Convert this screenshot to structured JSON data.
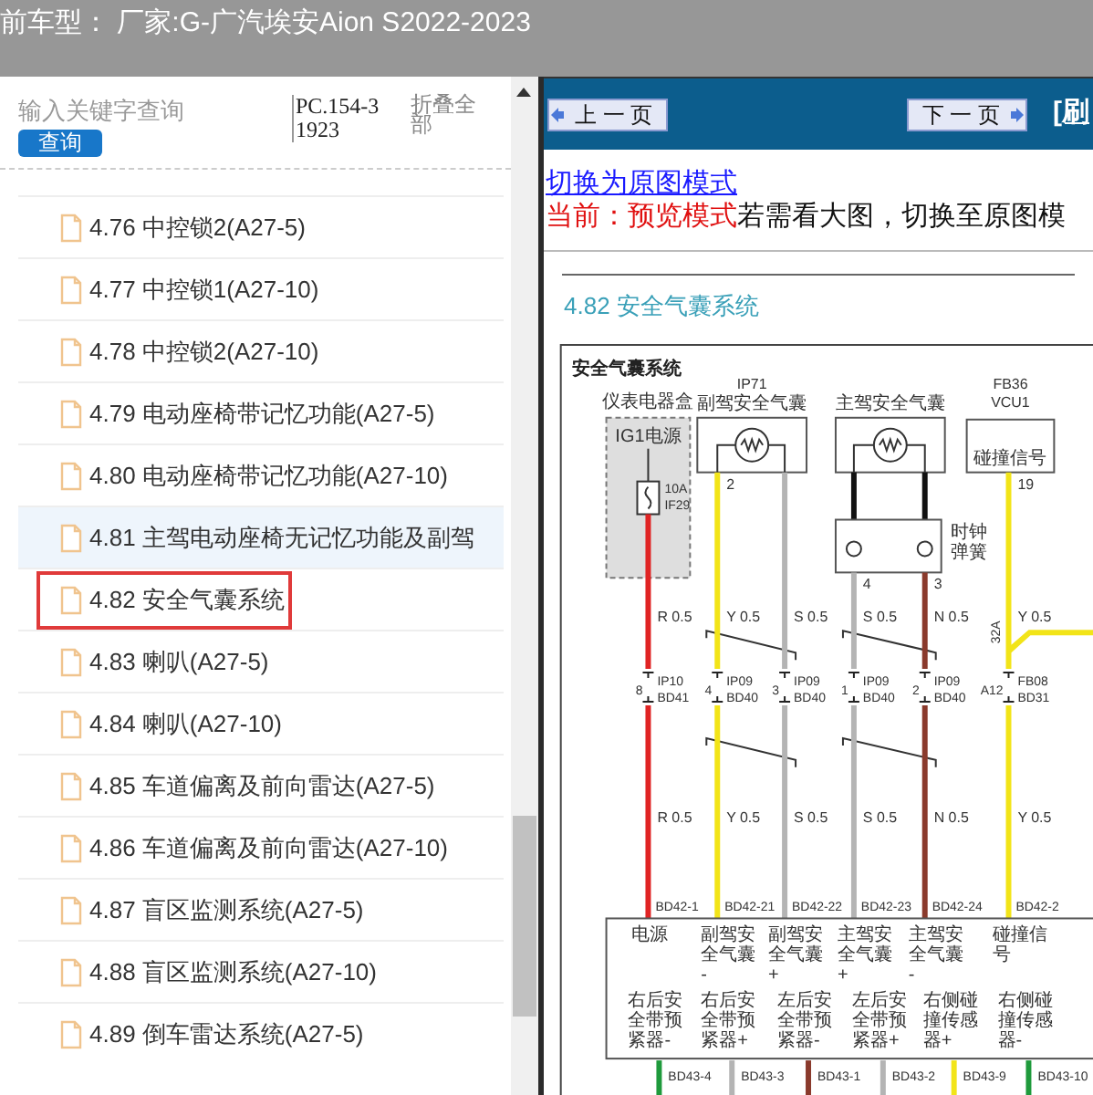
{
  "header": {
    "title": "前车型： 厂家:G-广汽埃安Aion S2022-2023"
  },
  "sidebar": {
    "search": {
      "placeholder": "输入关键字查询"
    },
    "search_button": "查询",
    "code": "PC.154-31923",
    "collapse": "折叠全部",
    "items": [
      {
        "label": "4.76 中控锁2(A27-5)",
        "selected": false,
        "boxed": false
      },
      {
        "label": "4.77 中控锁1(A27-10)",
        "selected": false,
        "boxed": false
      },
      {
        "label": "4.78 中控锁2(A27-10)",
        "selected": false,
        "boxed": false
      },
      {
        "label": "4.79 电动座椅带记忆功能(A27-5)",
        "selected": false,
        "boxed": false
      },
      {
        "label": "4.80 电动座椅带记忆功能(A27-10)",
        "selected": false,
        "boxed": false
      },
      {
        "label": "4.81 主驾电动座椅无记忆功能及副驾",
        "selected": true,
        "boxed": false
      },
      {
        "label": "4.82 安全气囊系统",
        "selected": false,
        "boxed": true
      },
      {
        "label": "4.83 喇叭(A27-5)",
        "selected": false,
        "boxed": false
      },
      {
        "label": "4.84 喇叭(A27-10)",
        "selected": false,
        "boxed": false
      },
      {
        "label": "4.85 车道偏离及前向雷达(A27-5)",
        "selected": false,
        "boxed": false
      },
      {
        "label": "4.86 车道偏离及前向雷达(A27-10)",
        "selected": false,
        "boxed": false
      },
      {
        "label": "4.87 盲区监测系统(A27-5)",
        "selected": false,
        "boxed": false
      },
      {
        "label": "4.88 盲区监测系统(A27-10)",
        "selected": false,
        "boxed": false
      },
      {
        "label": "4.89 倒车雷达系统(A27-5)",
        "selected": false,
        "boxed": false
      }
    ]
  },
  "viewer": {
    "prev": "上 一 页",
    "next": "下 一 页",
    "refresh": "[刷",
    "mode_link": "切换为原图模式",
    "mode_status": "当前：预览模式",
    "mode_hint": "若需看大图，切换至原图模",
    "doc_title": "4.82 安全气囊系统",
    "diagram": {
      "title": "安全气囊系统",
      "modules": [
        {
          "kind": "fuse_box",
          "label": "仪表电器盒",
          "inner": "IG1电源",
          "fuse": "10A",
          "fuse_id": "IF29"
        },
        {
          "kind": "airbag",
          "code": "IP71",
          "label": "副驾安全气囊"
        },
        {
          "kind": "airbag",
          "label": "主驾安全气囊"
        },
        {
          "kind": "clock_spring",
          "label": "时钟弹簧"
        },
        {
          "kind": "ecu",
          "code": "FB36",
          "code2": "VCU1",
          "signal": "碰撞信号"
        }
      ],
      "wires": [
        {
          "color": "#e02424",
          "upper_label": "R 0.5",
          "connector_pin": "8",
          "connector": "IP10",
          "connector2": "BD41",
          "lower_label": "R 0.5",
          "terminal": "BD42-1",
          "function": "电源"
        },
        {
          "color": "#f2e418",
          "pin": "2",
          "upper_label": "Y 0.5",
          "connector_pin": "4",
          "connector": "IP09",
          "connector2": "BD40",
          "lower_label": "Y 0.5",
          "terminal": "BD42-21",
          "function": "副驾安全气囊-"
        },
        {
          "color": "#b4b4b4",
          "upper_label": "S 0.5",
          "connector_pin": "3",
          "connector": "IP09",
          "connector2": "BD40",
          "lower_label": "S 0.5",
          "terminal": "BD42-22",
          "function": "副驾安全气囊+"
        },
        {
          "color": "#b4b4b4",
          "pin": "4",
          "upper_label": "S 0.5",
          "connector_pin": "1",
          "connector": "IP09",
          "connector2": "BD40",
          "lower_label": "S 0.5",
          "terminal": "BD42-23",
          "function": "主驾安全气囊+"
        },
        {
          "color": "#8a3a2c",
          "pin": "3",
          "upper_label": "N 0.5",
          "connector_pin": "2",
          "connector": "IP09",
          "connector2": "BD40",
          "lower_label": "N 0.5",
          "terminal": "BD42-24",
          "function": "主驾安全气囊-"
        },
        {
          "color": "#f2e418",
          "pin": "19",
          "splice": "32A",
          "upper_label": "Y 0.5",
          "connector_pin": "A12",
          "connector": "FB08",
          "connector2": "BD31",
          "lower_label": "Y 0.5",
          "terminal": "BD42-2",
          "function": "碰撞信号"
        }
      ],
      "outputs": [
        {
          "label": "右后安全带预紧器-",
          "terminal": "BD43-4",
          "color": "#1f9a3c"
        },
        {
          "label": "右后安全带预紧器+",
          "terminal": "BD43-3",
          "color": "#b4b4b4"
        },
        {
          "label": "左后安全带预紧器-",
          "terminal": "BD43-1",
          "color": "#8a3a2c"
        },
        {
          "label": "左后安全带预紧器+",
          "terminal": "BD43-2",
          "color": "#b4b4b4"
        },
        {
          "label": "右侧碰撞传感器+",
          "terminal": "BD43-9",
          "color": "#f2e418"
        },
        {
          "label": "右侧碰撞传感器-",
          "terminal": "BD43-10",
          "color": "#1f9a3c"
        }
      ]
    }
  }
}
